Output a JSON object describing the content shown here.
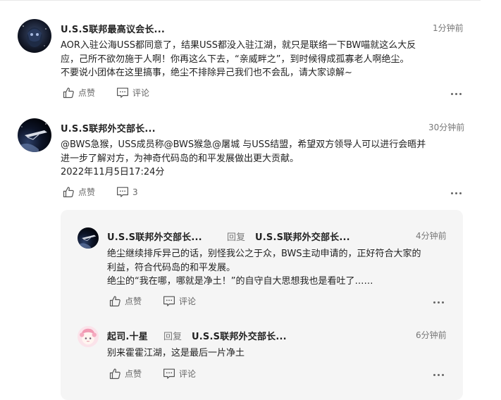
{
  "comments": [
    {
      "username": "U.S.S联邦最高议会长...",
      "time": "1分钟前",
      "lines": [
        "AOR入驻公海USS都同意了，结果USS都没入驻江湖，就只是联络一下BW喵就这么大反",
        "应，己所不欲勿施于人啊！你再这么下去，“亲威畔之”，到时候得成孤寡老人啊绝尘。",
        "不要说小团体在这里搞事，绝尘不排除异己我们也不会乱，请大家谅解~"
      ],
      "like_label": "点赞",
      "comment_label": "评论"
    },
    {
      "username": "U.S.S联邦外交部长...",
      "time": "30分钟前",
      "lines": [
        "@BWS急猴，USS成员称@BWS猴急@屠城 与USS结盟，希望双方领导人可以进行会晤并",
        "进一步了解对方，为神奇代码岛的和平发展做出更大贡献。"
      ],
      "date": "2022年11月5日17:24分",
      "like_label": "点赞",
      "comment_count": "3"
    }
  ],
  "replies": [
    {
      "username": "U.S.S联邦外交部长...",
      "reply_word": "回复",
      "reply_to": "U.S.S联邦外交部长...",
      "time": "4分钟前",
      "lines": [
        "绝尘继续排斥异己的话，别怪我公之于众，BWS主动申请的，正好符合大家的",
        "利益，符合代码岛的和平发展。",
        "绝尘的“我在哪，哪就是净土！”的自守自大思想我也是看吐了……"
      ],
      "like_label": "点赞",
      "comment_label": "评论"
    },
    {
      "username": "起司.十星",
      "reply_word": "回复",
      "reply_to": "U.S.S联邦外交部长...",
      "time": "6分钟前",
      "lines": [
        "别来霍霍江湖，这是最后一片净土"
      ],
      "like_label": "点赞",
      "comment_label": "评论"
    }
  ],
  "icons": {
    "like": "thumbs-up-icon",
    "comment": "comment-bubble-icon",
    "more": "more-ellipsis-icon"
  },
  "colors": {
    "text": "#222222",
    "muted": "#777777",
    "reply_bg": "#f5f5f5"
  }
}
